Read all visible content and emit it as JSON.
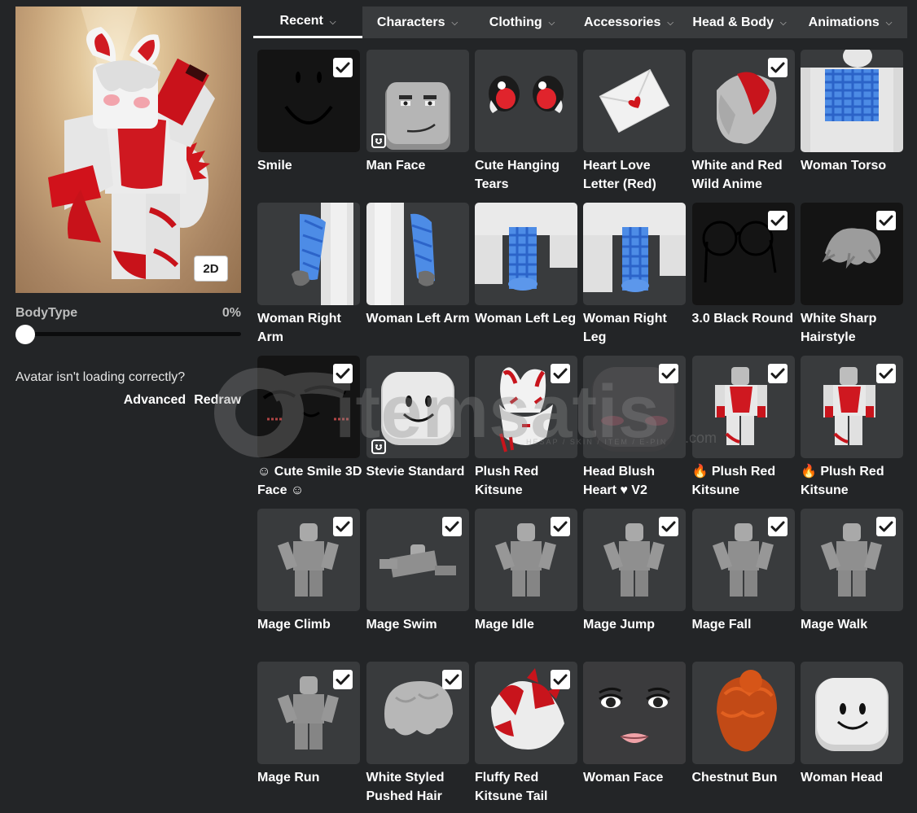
{
  "colors": {
    "background": "#232527",
    "tile": "#393b3d",
    "tabbar": "#393b3d",
    "text": "#ffffff",
    "muted": "#bdbebe"
  },
  "preview": {
    "toggle_label": "2D"
  },
  "bodytype": {
    "label": "BodyType",
    "value": "0%",
    "percent": 0
  },
  "loading": {
    "message": "Avatar isn't loading correctly?",
    "advanced": "Advanced",
    "redraw": "Redraw"
  },
  "tabs": [
    {
      "label": "Recent",
      "active": true
    },
    {
      "label": "Characters"
    },
    {
      "label": "Clothing"
    },
    {
      "label": "Accessories"
    },
    {
      "label": "Head & Body"
    },
    {
      "label": "Animations"
    }
  ],
  "items": [
    {
      "name": "Smile",
      "checked": true,
      "icon": "smile-face"
    },
    {
      "name": "Man Face",
      "checked": false,
      "badge": true,
      "icon": "man-face"
    },
    {
      "name": "Cute Hanging Tears",
      "checked": false,
      "icon": "tear-eyes"
    },
    {
      "name": "Heart Love Letter (Red)",
      "checked": false,
      "icon": "love-letter"
    },
    {
      "name": "White and Red Wild Anime",
      "checked": true,
      "icon": "anime-hair"
    },
    {
      "name": "Woman Torso",
      "checked": false,
      "icon": "woman-torso"
    },
    {
      "name": "Woman Right Arm",
      "checked": false,
      "icon": "right-arm"
    },
    {
      "name": "Woman Left Arm",
      "checked": false,
      "icon": "left-arm"
    },
    {
      "name": "Woman Left Leg",
      "checked": false,
      "icon": "left-leg"
    },
    {
      "name": "Woman Right Leg",
      "checked": false,
      "icon": "right-leg"
    },
    {
      "name": "3.0 Black Round",
      "checked": true,
      "icon": "round-glasses"
    },
    {
      "name": "White Sharp Hairstyle",
      "checked": true,
      "icon": "sharp-hair"
    },
    {
      "name": "☺ Cute Smile 3D Face ☺",
      "checked": true,
      "icon": "cute-smile-face"
    },
    {
      "name": "Stevie Standard",
      "checked": false,
      "badge": true,
      "icon": "stevie-head"
    },
    {
      "name": "Plush Red Kitsune",
      "checked": true,
      "icon": "kitsune-mask"
    },
    {
      "name": "Head Blush Heart ♥ V2",
      "checked": true,
      "icon": "blush-head"
    },
    {
      "name": "🔥 Plush Red Kitsune",
      "checked": true,
      "icon": "kitsune-outfit"
    },
    {
      "name": "🔥 Plush Red Kitsune",
      "checked": true,
      "icon": "kitsune-outfit"
    },
    {
      "name": "Mage Climb",
      "checked": true,
      "icon": "mage-figure"
    },
    {
      "name": "Mage Swim",
      "checked": true,
      "icon": "mage-swim"
    },
    {
      "name": "Mage Idle",
      "checked": true,
      "icon": "mage-figure"
    },
    {
      "name": "Mage Jump",
      "checked": true,
      "icon": "mage-figure"
    },
    {
      "name": "Mage Fall",
      "checked": true,
      "icon": "mage-figure"
    },
    {
      "name": "Mage Walk",
      "checked": true,
      "icon": "mage-figure"
    },
    {
      "name": "Mage Run",
      "checked": true,
      "icon": "mage-figure"
    },
    {
      "name": "White Styled Pushed Hair",
      "checked": true,
      "icon": "pushed-hair"
    },
    {
      "name": "Fluffy Red Kitsune Tail",
      "checked": true,
      "icon": "kitsune-tail"
    },
    {
      "name": "Woman Face",
      "checked": false,
      "icon": "woman-face"
    },
    {
      "name": "Chestnut Bun",
      "checked": false,
      "icon": "chestnut-bun"
    },
    {
      "name": "Woman Head",
      "checked": false,
      "icon": "woman-head"
    }
  ],
  "watermark": {
    "brand": "itemsatis",
    "tagline": "HESAP / SKIN / ITEM / E-PIN",
    "suffix": ".com"
  }
}
